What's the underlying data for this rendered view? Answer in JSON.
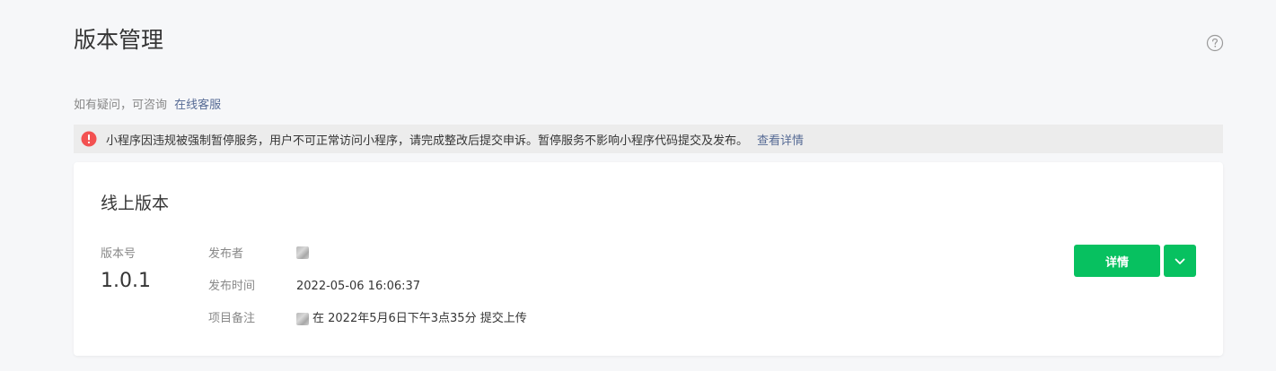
{
  "header": {
    "title": "版本管理",
    "help_icon": "question-circle-icon"
  },
  "consult": {
    "prefix": "如有疑问，可咨询",
    "link_label": "在线客服"
  },
  "alert": {
    "icon": "exclamation-circle-icon",
    "color": "#f35151",
    "message": "小程序因违规被强制暂停服务，用户不可正常访问小程序，请完成整改后提交申诉。暂停服务不影响小程序代码提交及发布。",
    "link_label": "查看详情"
  },
  "online_version": {
    "title": "线上版本",
    "version_label": "版本号",
    "version_number": "1.0.1",
    "publisher_label": "发布者",
    "publish_time_label": "发布时间",
    "publish_time": "2022-05-06 16:06:37",
    "remark_label": "项目备注",
    "remark_text": "在 2022年5月6日下午3点35分 提交上传",
    "detail_button": "详情",
    "dropdown_icon": "chevron-down-icon"
  },
  "colors": {
    "accent_green": "#07c160",
    "link_blue": "#576b95",
    "alert_red": "#f35151"
  }
}
